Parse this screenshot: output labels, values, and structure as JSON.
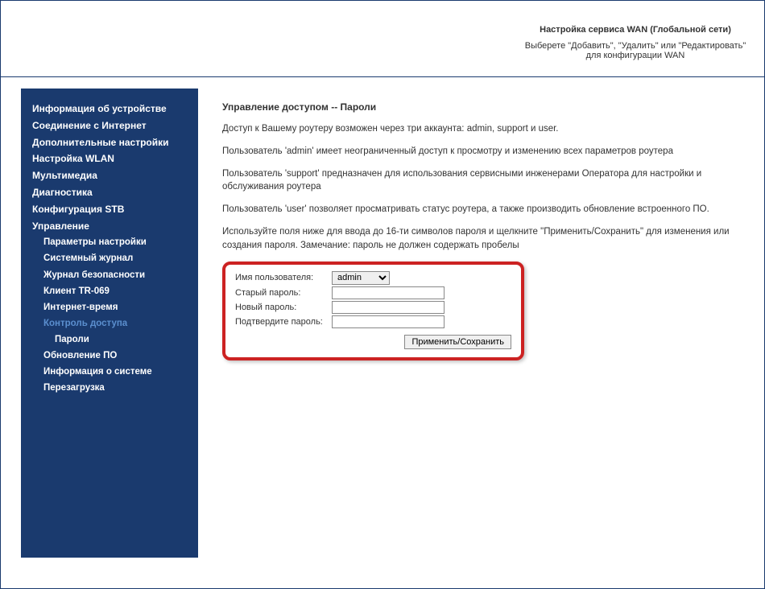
{
  "header": {
    "wan_title": "Настройка сервиса WAN (Глобальной сети)",
    "wan_desc": "Выберете \"Добавить\", \"Удалить\" или \"Редактировать\" для конфигурации WAN"
  },
  "sidebar": {
    "items": [
      {
        "label": "Информация об устройстве",
        "bold": true
      },
      {
        "label": "Соединение с Интернет",
        "bold": true
      },
      {
        "label": "Дополнительные настройки",
        "bold": true
      },
      {
        "label": "Настройка WLAN",
        "bold": true
      },
      {
        "label": "Мультимедиа",
        "bold": true
      },
      {
        "label": "Диагностика",
        "bold": true
      },
      {
        "label": "Конфигурация STB",
        "bold": true
      },
      {
        "label": "Управление",
        "bold": true
      },
      {
        "label": "Параметры настройки",
        "sub": true
      },
      {
        "label": "Системный журнал",
        "sub": true
      },
      {
        "label": "Журнал безопасности",
        "sub": true
      },
      {
        "label": "Клиент TR-069",
        "sub": true
      },
      {
        "label": "Интернет-время",
        "sub": true
      },
      {
        "label": "Контроль доступа",
        "sub": true,
        "active": true
      },
      {
        "label": "Пароли",
        "subsub": true
      },
      {
        "label": "Обновление ПО",
        "sub": true
      },
      {
        "label": "Информация о системе",
        "sub": true
      },
      {
        "label": "Перезагрузка",
        "sub": true
      }
    ]
  },
  "main": {
    "title": "Управление доступом -- Пароли",
    "p1": "Доступ к Вашему роутеру возможен через три аккаунта: admin, support и user.",
    "p2": "Пользователь 'admin' имеет неограниченный доступ к просмотру и изменению всех параметров роутера",
    "p3": "Пользователь 'support' предназначен для использования сервисными инженерами Оператора для настройки и обслуживания роутера",
    "p4": "Пользователь 'user' позволяет просматривать статус роутера, а также производить обновление встроенного ПО.",
    "p5": "Используйте поля ниже для ввода до 16-ти символов пароля и щелкните \"Применить/Сохранить\" для изменения или создания пароля. Замечание: пароль не должен содержать пробелы",
    "form": {
      "username_label": "Имя пользователя:",
      "username_value": "admin",
      "old_password_label": "Старый пароль:",
      "new_password_label": "Новый пароль:",
      "confirm_password_label": "Подтвердите пароль:",
      "apply_label": "Применить/Сохранить"
    }
  }
}
